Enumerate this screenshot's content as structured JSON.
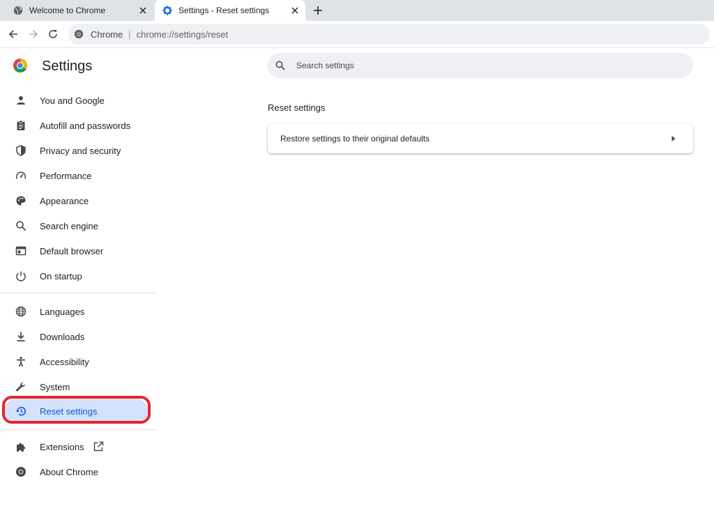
{
  "tabs": [
    {
      "title": "Welcome to Chrome",
      "icon": "globe-icon",
      "active": false
    },
    {
      "title": "Settings - Reset settings",
      "icon": "gear-icon",
      "active": true
    }
  ],
  "toolbar": {
    "site_label": "Chrome",
    "url_host": "chrome://",
    "url_path": "settings/reset"
  },
  "header": {
    "title": "Settings",
    "search_placeholder": "Search settings"
  },
  "sidebar": {
    "items": [
      {
        "label": "You and Google",
        "icon": "person-icon"
      },
      {
        "label": "Autofill and passwords",
        "icon": "clipboard-icon"
      },
      {
        "label": "Privacy and security",
        "icon": "shield-icon"
      },
      {
        "label": "Performance",
        "icon": "speedometer-icon"
      },
      {
        "label": "Appearance",
        "icon": "palette-icon"
      },
      {
        "label": "Search engine",
        "icon": "search-icon"
      },
      {
        "label": "Default browser",
        "icon": "browser-window-icon"
      },
      {
        "label": "On startup",
        "icon": "power-icon"
      },
      {
        "label": "Languages",
        "icon": "globe-icon"
      },
      {
        "label": "Downloads",
        "icon": "download-icon"
      },
      {
        "label": "Accessibility",
        "icon": "accessibility-icon"
      },
      {
        "label": "System",
        "icon": "wrench-icon"
      },
      {
        "label": "Reset settings",
        "icon": "restore-icon",
        "selected": true
      },
      {
        "label": "Extensions",
        "icon": "puzzle-icon"
      },
      {
        "label": "About Chrome",
        "icon": "chrome-logo-icon"
      }
    ]
  },
  "main": {
    "section_title": "Reset settings",
    "row_label": "Restore settings to their original defaults"
  },
  "colors": {
    "accent": "#0b57d0",
    "selected_bg": "#d3e3fd",
    "highlight_outline": "#e5262e"
  }
}
